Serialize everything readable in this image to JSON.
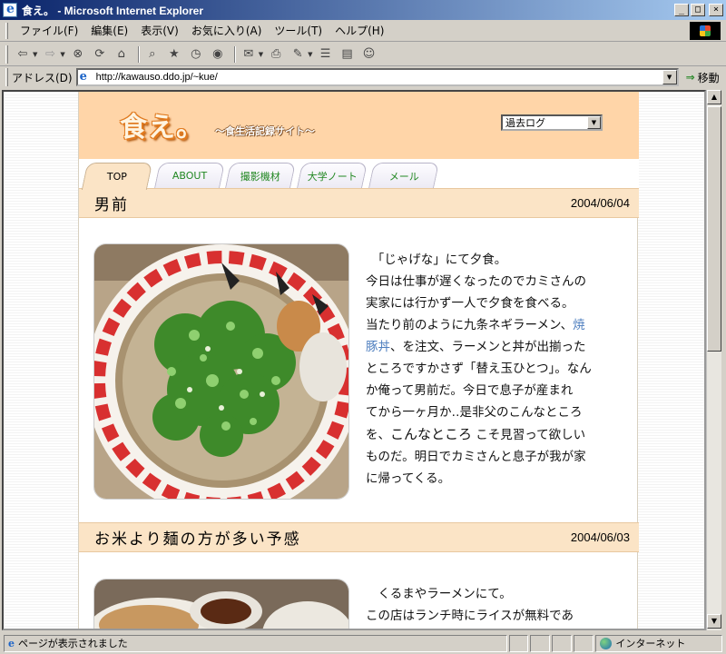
{
  "window": {
    "title": "食え。 - Microsoft Internet Explorer",
    "min": "_",
    "max": "□",
    "close": "×"
  },
  "menu": {
    "items": [
      "ファイル(F)",
      "編集(E)",
      "表示(V)",
      "お気に入り(A)",
      "ツール(T)",
      "ヘルプ(H)"
    ]
  },
  "toolbar": {
    "icons": [
      "back-icon",
      "forward-icon",
      "stop-icon",
      "refresh-icon",
      "home-icon",
      "search-icon",
      "favorites-icon",
      "history-icon",
      "mail-icon",
      "print-icon",
      "edit-icon",
      "discuss-icon",
      "messenger-icon"
    ]
  },
  "address": {
    "label": "アドレス(D)",
    "url": "http://kawauso.ddo.jp/~kue/",
    "go": "移動"
  },
  "site": {
    "logo": "食え。",
    "tagline": "〜食生活記録サイト〜",
    "archive_select": "過去ログ",
    "tabs": [
      "TOP",
      "ABOUT",
      "撮影機材",
      "大学ノート",
      "メール"
    ]
  },
  "posts": [
    {
      "title": "男前",
      "date": "2004/06/04",
      "lines": [
        "「じゃげな」にて夕食。",
        "今日は仕事が遅くなったのでカミさんの",
        "実家には行かず一人で夕食を食べる。",
        "当たり前のように九条ネギラーメン、",
        "焼",
        "豚丼",
        "、を注文、ラーメンと丼が出揃った",
        "ところですかさず「替え玉ひとつ」。なん",
        "か俺って男前だ。今日で息子が産まれ",
        "てから一ヶ月か‥是非父のこんなところ",
        "を、",
        "こんなところ",
        " こそ見習って欲しい",
        "ものだ。明日でカミさんと息子が我が家",
        "に帰ってくる。"
      ]
    },
    {
      "title": "お米より麺の方が多い予感",
      "date": "2004/06/03",
      "lines": [
        "くるまやラーメンにて。",
        "この店はランチ時にライスが無料であ"
      ]
    }
  ],
  "status": {
    "message": "ページが表示されました",
    "zone": "インターネット"
  },
  "colors": {
    "header_bg": "#ffd5a8",
    "post_header_bg": "#fbe4c6",
    "link": "#4f7fbf",
    "tab_text": "#228822"
  }
}
